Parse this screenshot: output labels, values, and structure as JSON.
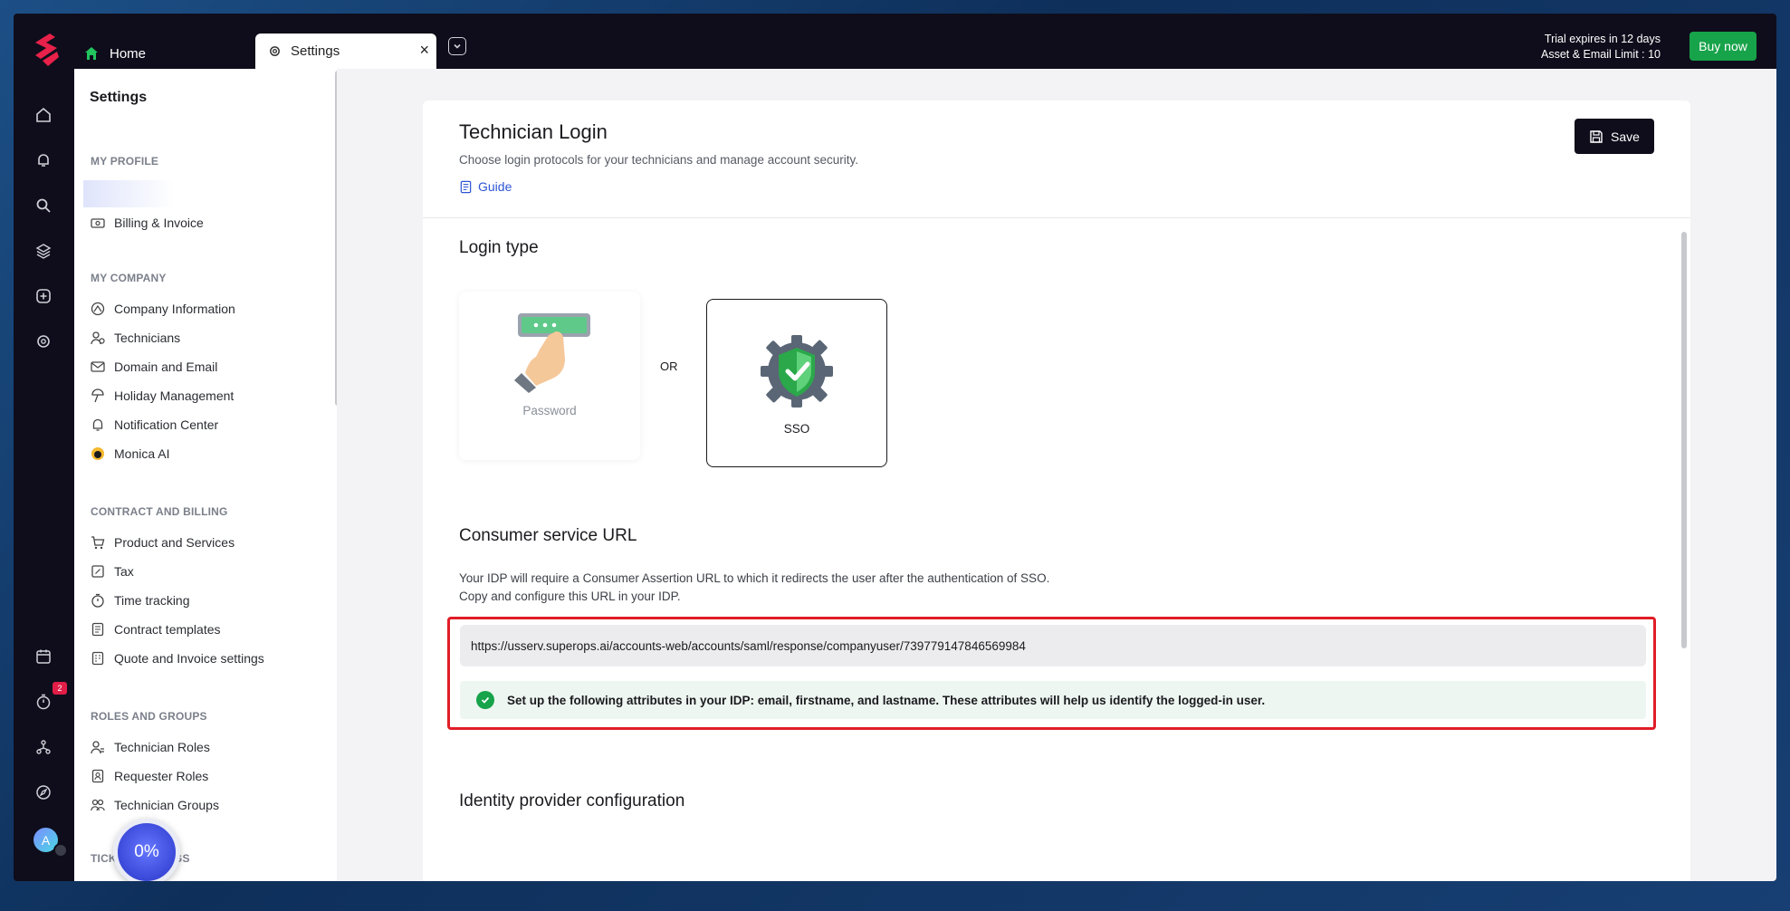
{
  "tabs": {
    "home_label": "Home",
    "settings_label": "Settings",
    "close_glyph": "×"
  },
  "topbar": {
    "trial_text": "Trial expires in 12 days",
    "limit_text": "Asset & Email Limit : 10",
    "buy_label": "Buy now"
  },
  "rail": {
    "badge_count": "2",
    "avatar_initial": "A"
  },
  "sidebar": {
    "title": "Settings",
    "sections": {
      "my_profile": "MY PROFILE",
      "my_company": "MY COMPANY",
      "contract_billing": "CONTRACT AND BILLING",
      "roles_groups": "ROLES AND GROUPS",
      "ticket_settings": "TICKET SETTINGS"
    },
    "items": {
      "billing": "Billing & Invoice",
      "company_info": "Company Information",
      "technicians": "Technicians",
      "domain_email": "Domain and Email",
      "holiday": "Holiday Management",
      "notification": "Notification Center",
      "monica": "Monica AI",
      "products": "Product and Services",
      "tax": "Tax",
      "time_tracking": "Time tracking",
      "contract_templates": "Contract templates",
      "quote_invoice": "Quote and Invoice settings",
      "tech_roles": "Technician Roles",
      "req_roles": "Requester Roles",
      "tech_groups": "Technician Groups"
    },
    "progress_text": "0%"
  },
  "main": {
    "title": "Technician Login",
    "subtitle": "Choose login protocols for your technicians and manage account security.",
    "guide_label": "Guide",
    "save_label": "Save",
    "login_type_title": "Login type",
    "password_label": "Password",
    "or_label": "OR",
    "sso_label": "SSO",
    "consumer_title": "Consumer service URL",
    "consumer_desc_1": "Your IDP will require a Consumer Assertion URL to which it redirects the user after the authentication of SSO.",
    "consumer_desc_2": "Copy and configure this URL in your IDP.",
    "consumer_url": "https://usserv.superops.ai/accounts-web/accounts/saml/response/companyuser/739779147846569984",
    "attributes_note": "Set up the following attributes in your IDP: email, firstname, and lastname. These attributes will help us identify the logged-in user.",
    "idp_title": "Identity provider configuration"
  },
  "colors": {
    "accent_green": "#17a34a",
    "highlight_red": "#e01d27",
    "brand_red": "#e8214a",
    "link_blue": "#2f55d4"
  }
}
